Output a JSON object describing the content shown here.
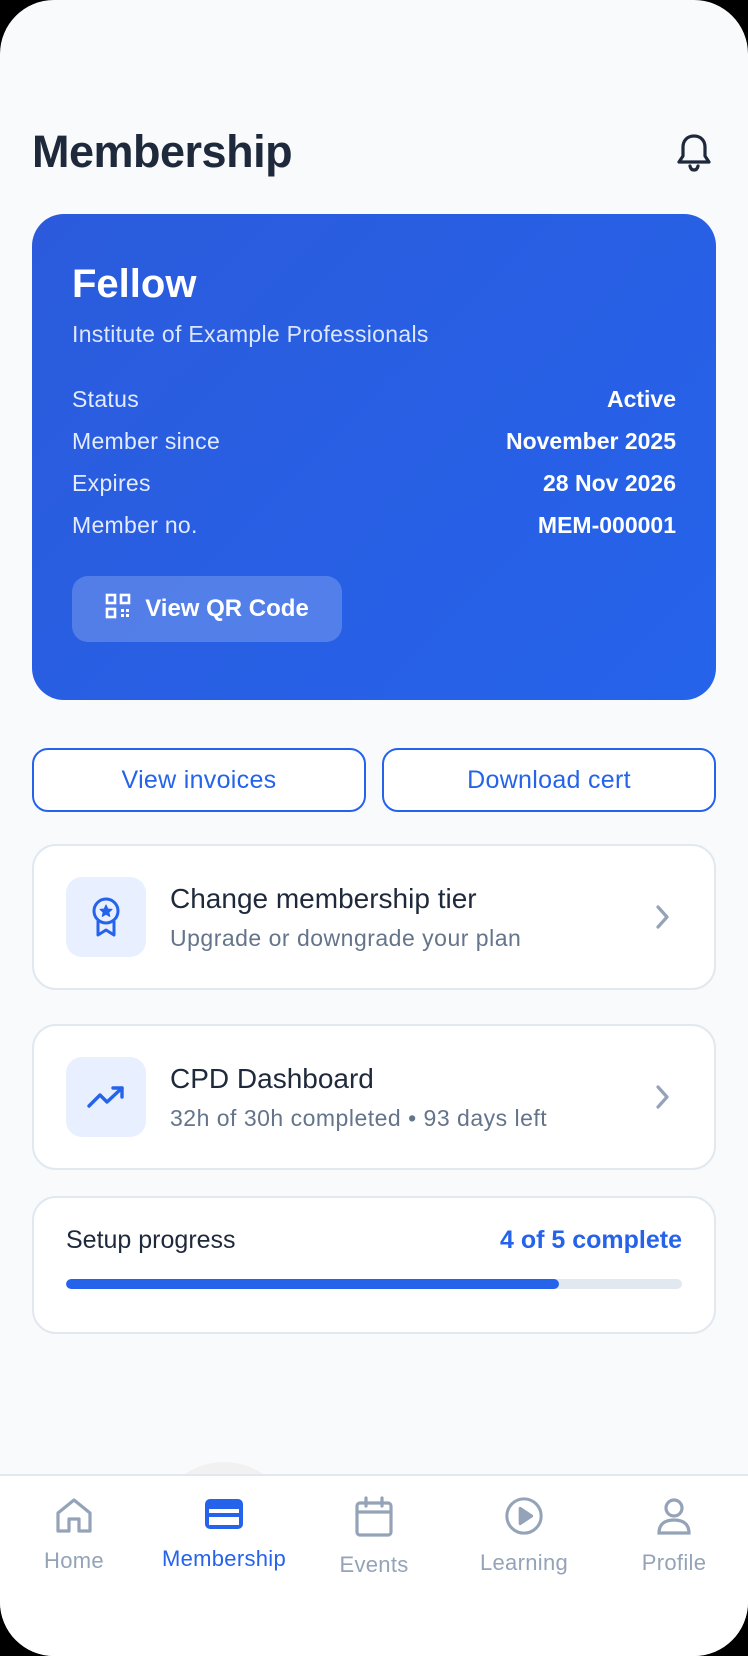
{
  "header": {
    "title": "Membership",
    "bell_icon": "bell-icon"
  },
  "membership_card": {
    "tier": "Fellow",
    "organization": "Institute of Example Professionals",
    "rows": [
      {
        "label": "Status",
        "value": "Active"
      },
      {
        "label": "Member since",
        "value": "November 2025"
      },
      {
        "label": "Expires",
        "value": "28 Nov 2026"
      },
      {
        "label": "Member no.",
        "value": "MEM-000001"
      }
    ],
    "qr_button": "View QR Code",
    "gradient": [
      "#2b5bdc",
      "#2563eb"
    ]
  },
  "actions": {
    "invoices": "View invoices",
    "certificate": "Download cert"
  },
  "tier_card": {
    "title": "Change membership tier",
    "subtitle": "Upgrade or downgrade your plan",
    "icon": "award-icon"
  },
  "cpd_card": {
    "title": "CPD Dashboard",
    "subtitle": "32h of 30h completed • 93 days left",
    "icon": "trending-up-icon"
  },
  "setup": {
    "label": "Setup progress",
    "status": "4 of 5 complete",
    "fraction": 0.8
  },
  "tabs": [
    {
      "label": "Home",
      "icon": "home-icon",
      "active": false
    },
    {
      "label": "Membership",
      "icon": "credit-card-icon",
      "active": true
    },
    {
      "label": "Events",
      "icon": "calendar-icon",
      "active": false
    },
    {
      "label": "Learning",
      "icon": "play-circle-icon",
      "active": false
    },
    {
      "label": "Profile",
      "icon": "user-icon",
      "active": false
    }
  ],
  "colors": {
    "accent": "#2563eb",
    "text": "#1e293b",
    "muted": "#64748b",
    "inactive": "#94a3b8"
  }
}
